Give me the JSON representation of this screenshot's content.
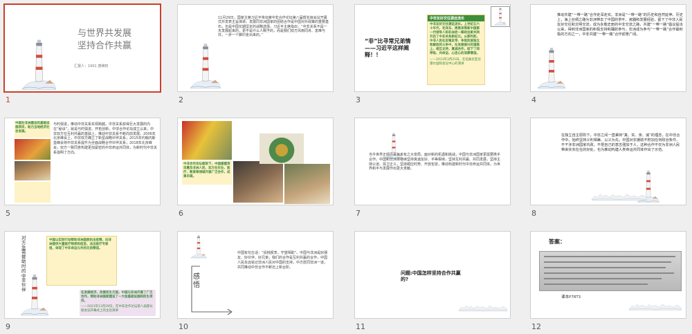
{
  "slides": [
    {
      "num": "1",
      "title_line1": "与世界共发展",
      "title_line2": "坚持合作共赢",
      "byline": "汇报人：1901 唐维权"
    },
    {
      "num": "2",
      "body": "11月29日，国家主席习近平将出席中非合作论坛第八届部长级会议开幕式并发表主旨演讲。发展同非洲国家的团结合作是中国对外政策的重要基石，也是中国长期坚定的战略选择。习近平主席指出：“中非关系不是一天发展起来的，更不是什么人赐予的，而是我们双方风雨同舟、患难与共，一步一个脚印走出来的。”"
    },
    {
      "num": "3",
      "heading": "“非”比寻常兄弟情——习近平这样阐释！！",
      "box_title": "中非友好交往源远流长",
      "box_body": "中非友好交往源远流长。上世纪五六十年代，毛泽东、周恩来等新中国第一代领导人和非洲老一辈政治家共同开启了中非关系新纪元。从那时起，中非人民在反殖反帝、争取民族独立和解放的斗争中，在发展振兴的道路上，相互支持，真诚合作，结下了同呼吸、共命运、心连心的深厚情谊。",
      "box_source": "——2013年3月25日，在坦桑尼亚尼雷尔国际会议中心的演讲"
    },
    {
      "num": "4",
      "body": "推动共建“一带一路”合作走深走实。非洲是“一带一路”的历史和自然延伸，历史上，海上丝绸之路为非洲带去了中国的茶叶、瓷器和发展经验，留下了中非人民友好交往和文明交流，成为永载史册的中非交流之路，共建“一带一路”倡议提出以来，得到非洲国家的积极支持和踊跃参与，非洲成为参与“一带一路”合作最积极的方向之一，中非共建“一带一路”合作前景广阔。"
    },
    {
      "num": "5",
      "body": "与时俱进，推动中非关系实现跨越。中非关系获得巨大发展的内在“秘诀”，就是与时俱进、开拓创新，中非合作论坛成立以来，中非双方在互利共赢的基础上，推动中非关系不断向前发展，2006年北京峰会上，中非双方确立了新型战略伙伴关系；2015年约翰内斯堡峰会将中非关系提升为全面战略合作伙伴关系；2018年北京峰会，双方一致同意构建更加紧密的中非命运共同体，为新时代中非关系指明了方向。",
      "green_caption": "中国在非洲建设的基础设施项目，助力当地经济社会发展。"
    },
    {
      "num": "6",
      "green_caption": "中非合作论坛框架下，中国援建项目惠及非洲人民，双方在农业、医疗、教育等领域开展广泛合作，成果丰硕。"
    },
    {
      "num": "7",
      "body": "当今世界正经历百年未有之大变局，面对新的机遇和挑战，中国与非洲国家更需要携手合作。中国和非洲将继续坚持真诚友好、平等相待，坚持互利共赢、共同发展，坚持主持公道、捍卫正义，坚持顺应时势、开放包容，推动构建新时代中非命运共同体，为世界和平与发展作出更大贡献。"
    },
    {
      "num": "8",
      "body": "在独立自主原则下，中非之间一直秉持“真、实、亲、诚”的理念，在中非合作中，始终坚持义利相兼、以义为先，中国对非援助不附加任何政治条件，不干涉非洲国家内政，不把自己的意志强加于人，这种合作不仅为非洲人民带来实实在在的好处，也为推动构建人类命运共同体作出了示范。"
    },
    {
      "num": "9",
      "vertical_text": "对方急需援助时的中非伙伴",
      "green_caption": "中国以实际行动帮助非洲国家抗击疫情，向非洲提供大量医疗物资和疫苗，派出医疗专家组，体现了中非命运与共的兄弟情谊。",
      "box_body": "在发展经济、改善民生方面，中国与非洲开展了广泛合作，帮助非洲国家建设了一大批基础设施和民生项目。",
      "box_source": "——2021年11月29日，在中非合作论坛第八届部长级会议开幕式上的主旨演讲"
    },
    {
      "num": "10",
      "vertical_text": "感悟",
      "body": "中国有句古话：“投桃报李，守望相助”。中国与非洲是好朋友、好伙伴、好兄弟，我们的合作是互利共赢的合作，中国人民永远铭记非洲人民对中国的支持，中方愿同非洲一道，共同推动中非合作不断迈上新台阶。"
    },
    {
      "num": "11",
      "question": "问题:中国怎样坚持合作共赢的?"
    },
    {
      "num": "12",
      "answer_label": "答案：",
      "textbook_ref": "课本P78T3"
    }
  ],
  "colors": {
    "selected_border": "#c8402a",
    "slide_border": "#cfcfcf",
    "canvas": "#efefef"
  }
}
